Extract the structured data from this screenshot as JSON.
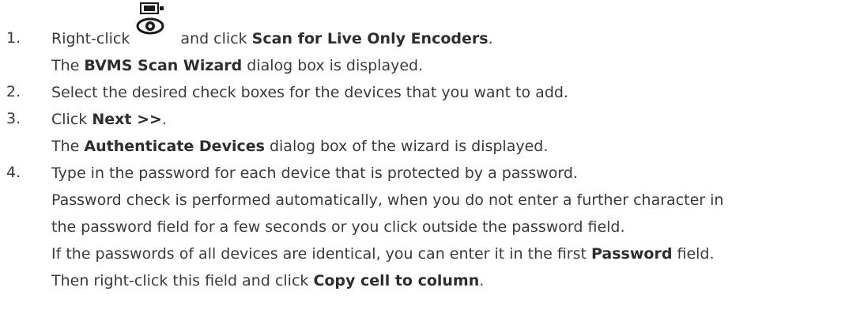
{
  "steps": [
    {
      "number": "1.",
      "lines": [
        {
          "segments": [
            {
              "text": "Right-click ",
              "bold": false
            },
            {
              "icon": "live-only-encoder-icon"
            },
            {
              "text": "and click ",
              "bold": false
            },
            {
              "text": "Scan for Live Only Encoders",
              "bold": true
            },
            {
              "text": ".",
              "bold": false
            }
          ]
        },
        {
          "segments": [
            {
              "text": "The ",
              "bold": false
            },
            {
              "text": "BVMS Scan Wizard",
              "bold": true
            },
            {
              "text": " dialog box is displayed.",
              "bold": false
            }
          ]
        }
      ]
    },
    {
      "number": "2.",
      "lines": [
        {
          "segments": [
            {
              "text": "Select the desired check boxes for the devices that you want to add.",
              "bold": false
            }
          ]
        }
      ]
    },
    {
      "number": "3.",
      "lines": [
        {
          "segments": [
            {
              "text": "Click ",
              "bold": false
            },
            {
              "text": "Next >>",
              "bold": true
            },
            {
              "text": ".",
              "bold": false
            }
          ]
        },
        {
          "segments": [
            {
              "text": "The ",
              "bold": false
            },
            {
              "text": "Authenticate Devices",
              "bold": true
            },
            {
              "text": " dialog box of the wizard is displayed.",
              "bold": false
            }
          ]
        }
      ]
    },
    {
      "number": "4.",
      "lines": [
        {
          "segments": [
            {
              "text": "Type in the password for each device that is protected by a password.",
              "bold": false
            }
          ]
        },
        {
          "segments": [
            {
              "text": "Password check is performed automatically, when you do not enter a further character in",
              "bold": false
            }
          ]
        },
        {
          "segments": [
            {
              "text": "the password field for a few seconds or you click outside the password field.",
              "bold": false
            }
          ]
        },
        {
          "segments": [
            {
              "text": "If the passwords of all devices are identical, you can enter it in the first ",
              "bold": false
            },
            {
              "text": "Password",
              "bold": true
            },
            {
              "text": " field.",
              "bold": false
            }
          ]
        },
        {
          "segments": [
            {
              "text": "Then right-click this field and click ",
              "bold": false
            },
            {
              "text": "Copy cell to column",
              "bold": true
            },
            {
              "text": ".",
              "bold": false
            }
          ]
        }
      ]
    }
  ]
}
